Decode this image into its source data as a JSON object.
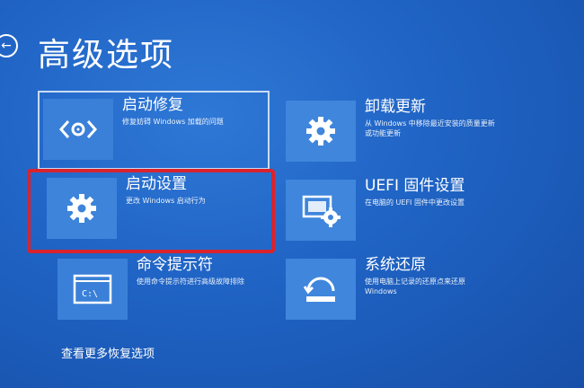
{
  "header": {
    "back_glyph": "←",
    "title": "高级选项"
  },
  "tiles": [
    {
      "id": "startup-repair",
      "title": "启动修复",
      "desc": "修复妨碍 Windows 加载的问题",
      "desc2": "",
      "icon": "code-brackets-icon"
    },
    {
      "id": "startup-settings",
      "title": "启动设置",
      "desc": "更改 Windows 启动行为",
      "desc2": "",
      "icon": "gear-icon"
    },
    {
      "id": "command-prompt",
      "title": "命令提示符",
      "desc": "使用命令提示符进行高级故障排除",
      "desc2": "",
      "icon": "terminal-icon"
    },
    {
      "id": "uninstall-updates",
      "title": "卸载更新",
      "desc": "从 Windows 中移除最近安装的质量更新",
      "desc2": "或功能更新",
      "icon": "gear-icon"
    },
    {
      "id": "uefi-settings",
      "title": "UEFI 固件设置",
      "desc": "在电脑的 UEFI 固件中更改设置",
      "desc2": "",
      "icon": "firmware-icon"
    },
    {
      "id": "system-restore",
      "title": "系统还原",
      "desc": "使用电脑上记录的还原点来还原",
      "desc2": "Windows",
      "icon": "restore-icon"
    }
  ],
  "footer": {
    "more_link": "查看更多恢复选项"
  },
  "colors": {
    "background": "#1f63c4",
    "highlight": "#d9232d"
  }
}
